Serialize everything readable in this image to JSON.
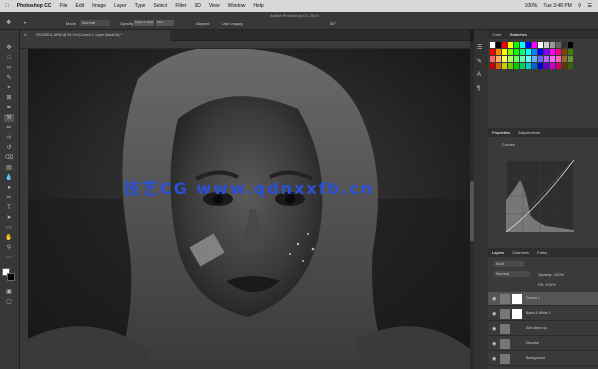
{
  "menubar": {
    "app": "Photoshop CC",
    "items": [
      "File",
      "Edit",
      "Image",
      "Layer",
      "Type",
      "Select",
      "Filter",
      "3D",
      "View",
      "Window",
      "Help"
    ],
    "window_title": "Adobe Photoshop CC 2019",
    "battery": "100%",
    "clock": "Tue 3:48 PM"
  },
  "options": {
    "mode_label": "Mode",
    "mode_value": "Normal",
    "opacity_label": "Opacity",
    "flow_label": "Flow",
    "erase_label": "Erase to History",
    "aligned": "Aligned",
    "sample_label": "Use Legacy",
    "angle": "30°"
  },
  "document": {
    "tab_label": "DSC05011.ARW @ 54.1% (Curves 1, Layer Mask/16) *"
  },
  "watermark": "技艺CG www.qdnxxfb.cn",
  "panels": {
    "color_tabs": [
      "Color",
      "Swatches"
    ],
    "props_tabs": [
      "Properties",
      "Adjustments"
    ],
    "props_title": "Curves",
    "layers_tabs": [
      "Layers",
      "Channels",
      "Paths"
    ],
    "kind": "Kind",
    "blend": "Normal",
    "opacity": "Opacity: 100%",
    "fill": "Fill: 100%",
    "layers": [
      {
        "name": "Curves 1",
        "selected": true,
        "mask": true
      },
      {
        "name": "Black & White 1",
        "selected": false,
        "mask": true
      },
      {
        "name": "Skin clean up",
        "selected": false,
        "mask": false
      },
      {
        "name": "Dissolve",
        "selected": false,
        "mask": false
      },
      {
        "name": "Background",
        "selected": false,
        "mask": false
      }
    ]
  },
  "colors": {
    "swatches_row1": [
      "#ffffff",
      "#000000",
      "#ff0000",
      "#ffff00",
      "#00ff00",
      "#00ffff",
      "#0000ff",
      "#ff00ff",
      "#ffffff",
      "#cccccc",
      "#999999",
      "#666666",
      "#333333",
      "#000000"
    ],
    "swatches_row2": [
      "#ff0000",
      "#ff8000",
      "#ffff00",
      "#80ff00",
      "#00ff00",
      "#00ff80",
      "#00ffff",
      "#0080ff",
      "#0000ff",
      "#8000ff",
      "#ff00ff",
      "#ff0080",
      "#804000",
      "#408000"
    ],
    "swatches_row3": [
      "#ff6666",
      "#ffb366",
      "#ffff66",
      "#b3ff66",
      "#66ff66",
      "#66ffb3",
      "#66ffff",
      "#66b3ff",
      "#6666ff",
      "#b366ff",
      "#ff66ff",
      "#ff66b3",
      "#996633",
      "#669933"
    ],
    "swatches_row4": [
      "#cc0000",
      "#cc6600",
      "#cccc00",
      "#66cc00",
      "#00cc00",
      "#00cc66",
      "#00cccc",
      "#0066cc",
      "#0000cc",
      "#6600cc",
      "#cc00cc",
      "#cc0066",
      "#663300",
      "#336600"
    ]
  }
}
